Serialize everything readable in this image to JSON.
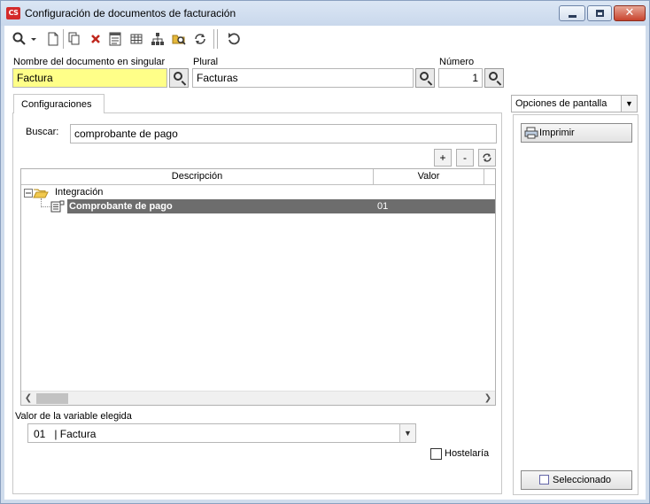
{
  "window": {
    "logo_text": "CS",
    "title": "Configuración de documentos de facturación"
  },
  "toolbar": {
    "icons": [
      "search-icon",
      "new-document-icon",
      "copy-icon",
      "delete-icon",
      "properties-icon",
      "table-icon",
      "hierarchy-icon",
      "folder-search-icon",
      "refresh-icon",
      "reload-icon"
    ]
  },
  "header": {
    "singular_label": "Nombre del documento en singular",
    "singular_value": "Factura",
    "plural_label": "Plural",
    "plural_value": "Facturas",
    "number_label": "Número",
    "number_value": "1"
  },
  "tabs": [
    {
      "label": "Configuraciones"
    }
  ],
  "search": {
    "label": "Buscar:",
    "value": "comprobante de pago"
  },
  "grid_buttons": {
    "add": "+",
    "remove": "-"
  },
  "grid": {
    "columns": [
      "Descripción",
      "Valor"
    ],
    "group": "Integración",
    "rows": [
      {
        "description": "Comprobante de pago",
        "value": "01"
      }
    ]
  },
  "variable": {
    "label": "Valor de la variable elegida",
    "selected": "01   | Factura"
  },
  "hosteleria": {
    "label": "Hostelaría",
    "checked": false
  },
  "right_panel": {
    "options_label": "Opciones de pantalla",
    "print_label": "Imprimir",
    "selected_label": "Seleccionado"
  }
}
